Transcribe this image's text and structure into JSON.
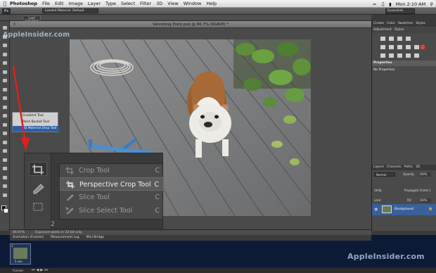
{
  "menubar": {
    "apple": "",
    "app_name": "Photoshop",
    "items": [
      "File",
      "Edit",
      "Image",
      "Layer",
      "Type",
      "Select",
      "Filter",
      "3D",
      "View",
      "Window",
      "Help"
    ],
    "clock": "Mon 2:10 AM"
  },
  "options_bar": {
    "ps_badge": "Ps",
    "loaded_material": "Loaded Material: Default",
    "workspace": "Essentials",
    "button": "Load Selected"
  },
  "document": {
    "tab_title": "Vanishing Point.psd @ 66.7% (RGB/8) *"
  },
  "watermark": {
    "top": "AppleInsider.com",
    "bottom": "AppleInsider.com"
  },
  "tool_flyout_small": [
    {
      "label": "Gradient Tool",
      "key": "G",
      "selected": false
    },
    {
      "label": "Paint Bucket Tool",
      "key": "G",
      "selected": false
    },
    {
      "label": "3D Material Drop Tool",
      "key": "G",
      "selected": true
    }
  ],
  "crop_flyout": [
    {
      "label": "Crop Tool",
      "key": "C",
      "active": false
    },
    {
      "label": "Perspective Crop Tool",
      "key": "C",
      "active": true
    },
    {
      "label": "Slice Tool",
      "key": "C",
      "active": false
    },
    {
      "label": "Slice Select Tool",
      "key": "C",
      "active": false
    }
  ],
  "right_panel": {
    "adjust_tabs": [
      "Adjustment",
      "Styles"
    ],
    "top_tabs": [
      "Create",
      "Color",
      "Swatches",
      "Styles"
    ],
    "properties_title": "Properties",
    "properties_empty": "No Properties",
    "layers_tabs": [
      "Layers",
      "Channels",
      "Paths",
      "3D"
    ],
    "blend_mode": "Normal",
    "opacity_label": "Opacity:",
    "opacity_value": "100%",
    "unify_label": "Unify:",
    "propagate_label": "Propagate Frame 1",
    "lock_label": "Lock:",
    "fill_label": "Fill:",
    "fill_value": "100%",
    "layer_name": "Background",
    "colors": {
      "accent": "#2d5ea6",
      "selected_layer": "#3a5f9a"
    }
  },
  "status_bar": {
    "zoom": "66.67%",
    "message": "Exposure works in 32-bit only"
  },
  "bottom_panel": {
    "tabs": [
      "Animation (Frames)",
      "Measurement Log",
      "Mini Bridge"
    ],
    "frame_delay": "5 sec.",
    "loop": "Forever",
    "frame_number": "1"
  },
  "zoom_number": "2"
}
